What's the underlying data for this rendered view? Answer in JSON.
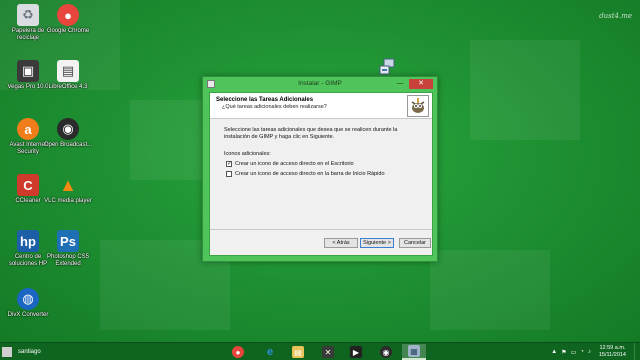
{
  "watermark": "dust4.me",
  "desktop_icons": [
    {
      "label": "Papelera de reciclaje",
      "icon": "recycle-bin-icon",
      "color": "#d9dde2"
    },
    {
      "label": "Google Chrome",
      "icon": "chrome-icon",
      "color": "#e8453c"
    },
    {
      "label": "Vegas Pro 10.0",
      "icon": "vegas-icon",
      "color": "#3a3a3a"
    },
    {
      "label": "LibreOffice 4.3",
      "icon": "libreoffice-icon",
      "color": "#f2f2f2"
    },
    {
      "label": "Avast Internet Security",
      "icon": "avast-icon",
      "color": "#f07c1a"
    },
    {
      "label": "Open Broadcast...",
      "icon": "obs-icon",
      "color": "#2b2b2b"
    },
    {
      "label": "CCleaner",
      "icon": "ccleaner-icon",
      "color": "#d03a2a"
    },
    {
      "label": "VLC media player",
      "icon": "vlc-icon",
      "color": "#f08a12"
    },
    {
      "label": "Centro de soluciones HP",
      "icon": "hp-icon",
      "color": "#1c5fa8"
    },
    {
      "label": "Photoshop CS5 Extended",
      "icon": "photoshop-icon",
      "color": "#1f6fb5"
    },
    {
      "label": "DivX Converter",
      "icon": "divx-icon",
      "color": "#1a66c2"
    }
  ],
  "dialog": {
    "title": "Instalar - GIMP",
    "minimize": "—",
    "close": "✕",
    "header_title": "Seleccione las Tareas Adicionales",
    "header_subtitle": "¿Qué tareas adicionales deben realizarse?",
    "description": "Seleccione las tareas adicionales que desea que se realicen durante la instalación de GIMP y haga clic en Siguiente.",
    "section_label": "Iconos adicionales:",
    "options": [
      {
        "label": "Crear un icono de acceso directo en el Escritorio",
        "checked": true
      },
      {
        "label": "Crear un icono de acceso directo en la barra de Inicio Rápido",
        "checked": false
      }
    ],
    "back_button": "< Atrás",
    "next_button": "Siguiente >",
    "cancel_button": "Cancelar"
  },
  "taskbar": {
    "user": "santiago",
    "apps": [
      {
        "icon": "chrome-icon",
        "color": "#e8453c",
        "glyph": "●"
      },
      {
        "icon": "internet-explorer-icon",
        "color": "#2a8fd6",
        "glyph": "e"
      },
      {
        "icon": "file-explorer-icon",
        "color": "#e8c35a",
        "glyph": "▤"
      },
      {
        "icon": "vegas-icon",
        "color": "#3a3a3a",
        "glyph": "✕"
      },
      {
        "icon": "media-icon",
        "color": "#222222",
        "glyph": "▶"
      },
      {
        "icon": "obs-icon",
        "color": "#2b2b2b",
        "glyph": "◉"
      },
      {
        "icon": "installer-icon",
        "color": "#9fb3c8",
        "glyph": "▦"
      }
    ],
    "time": "12:59 a.m.",
    "date": "15/11/2014"
  }
}
